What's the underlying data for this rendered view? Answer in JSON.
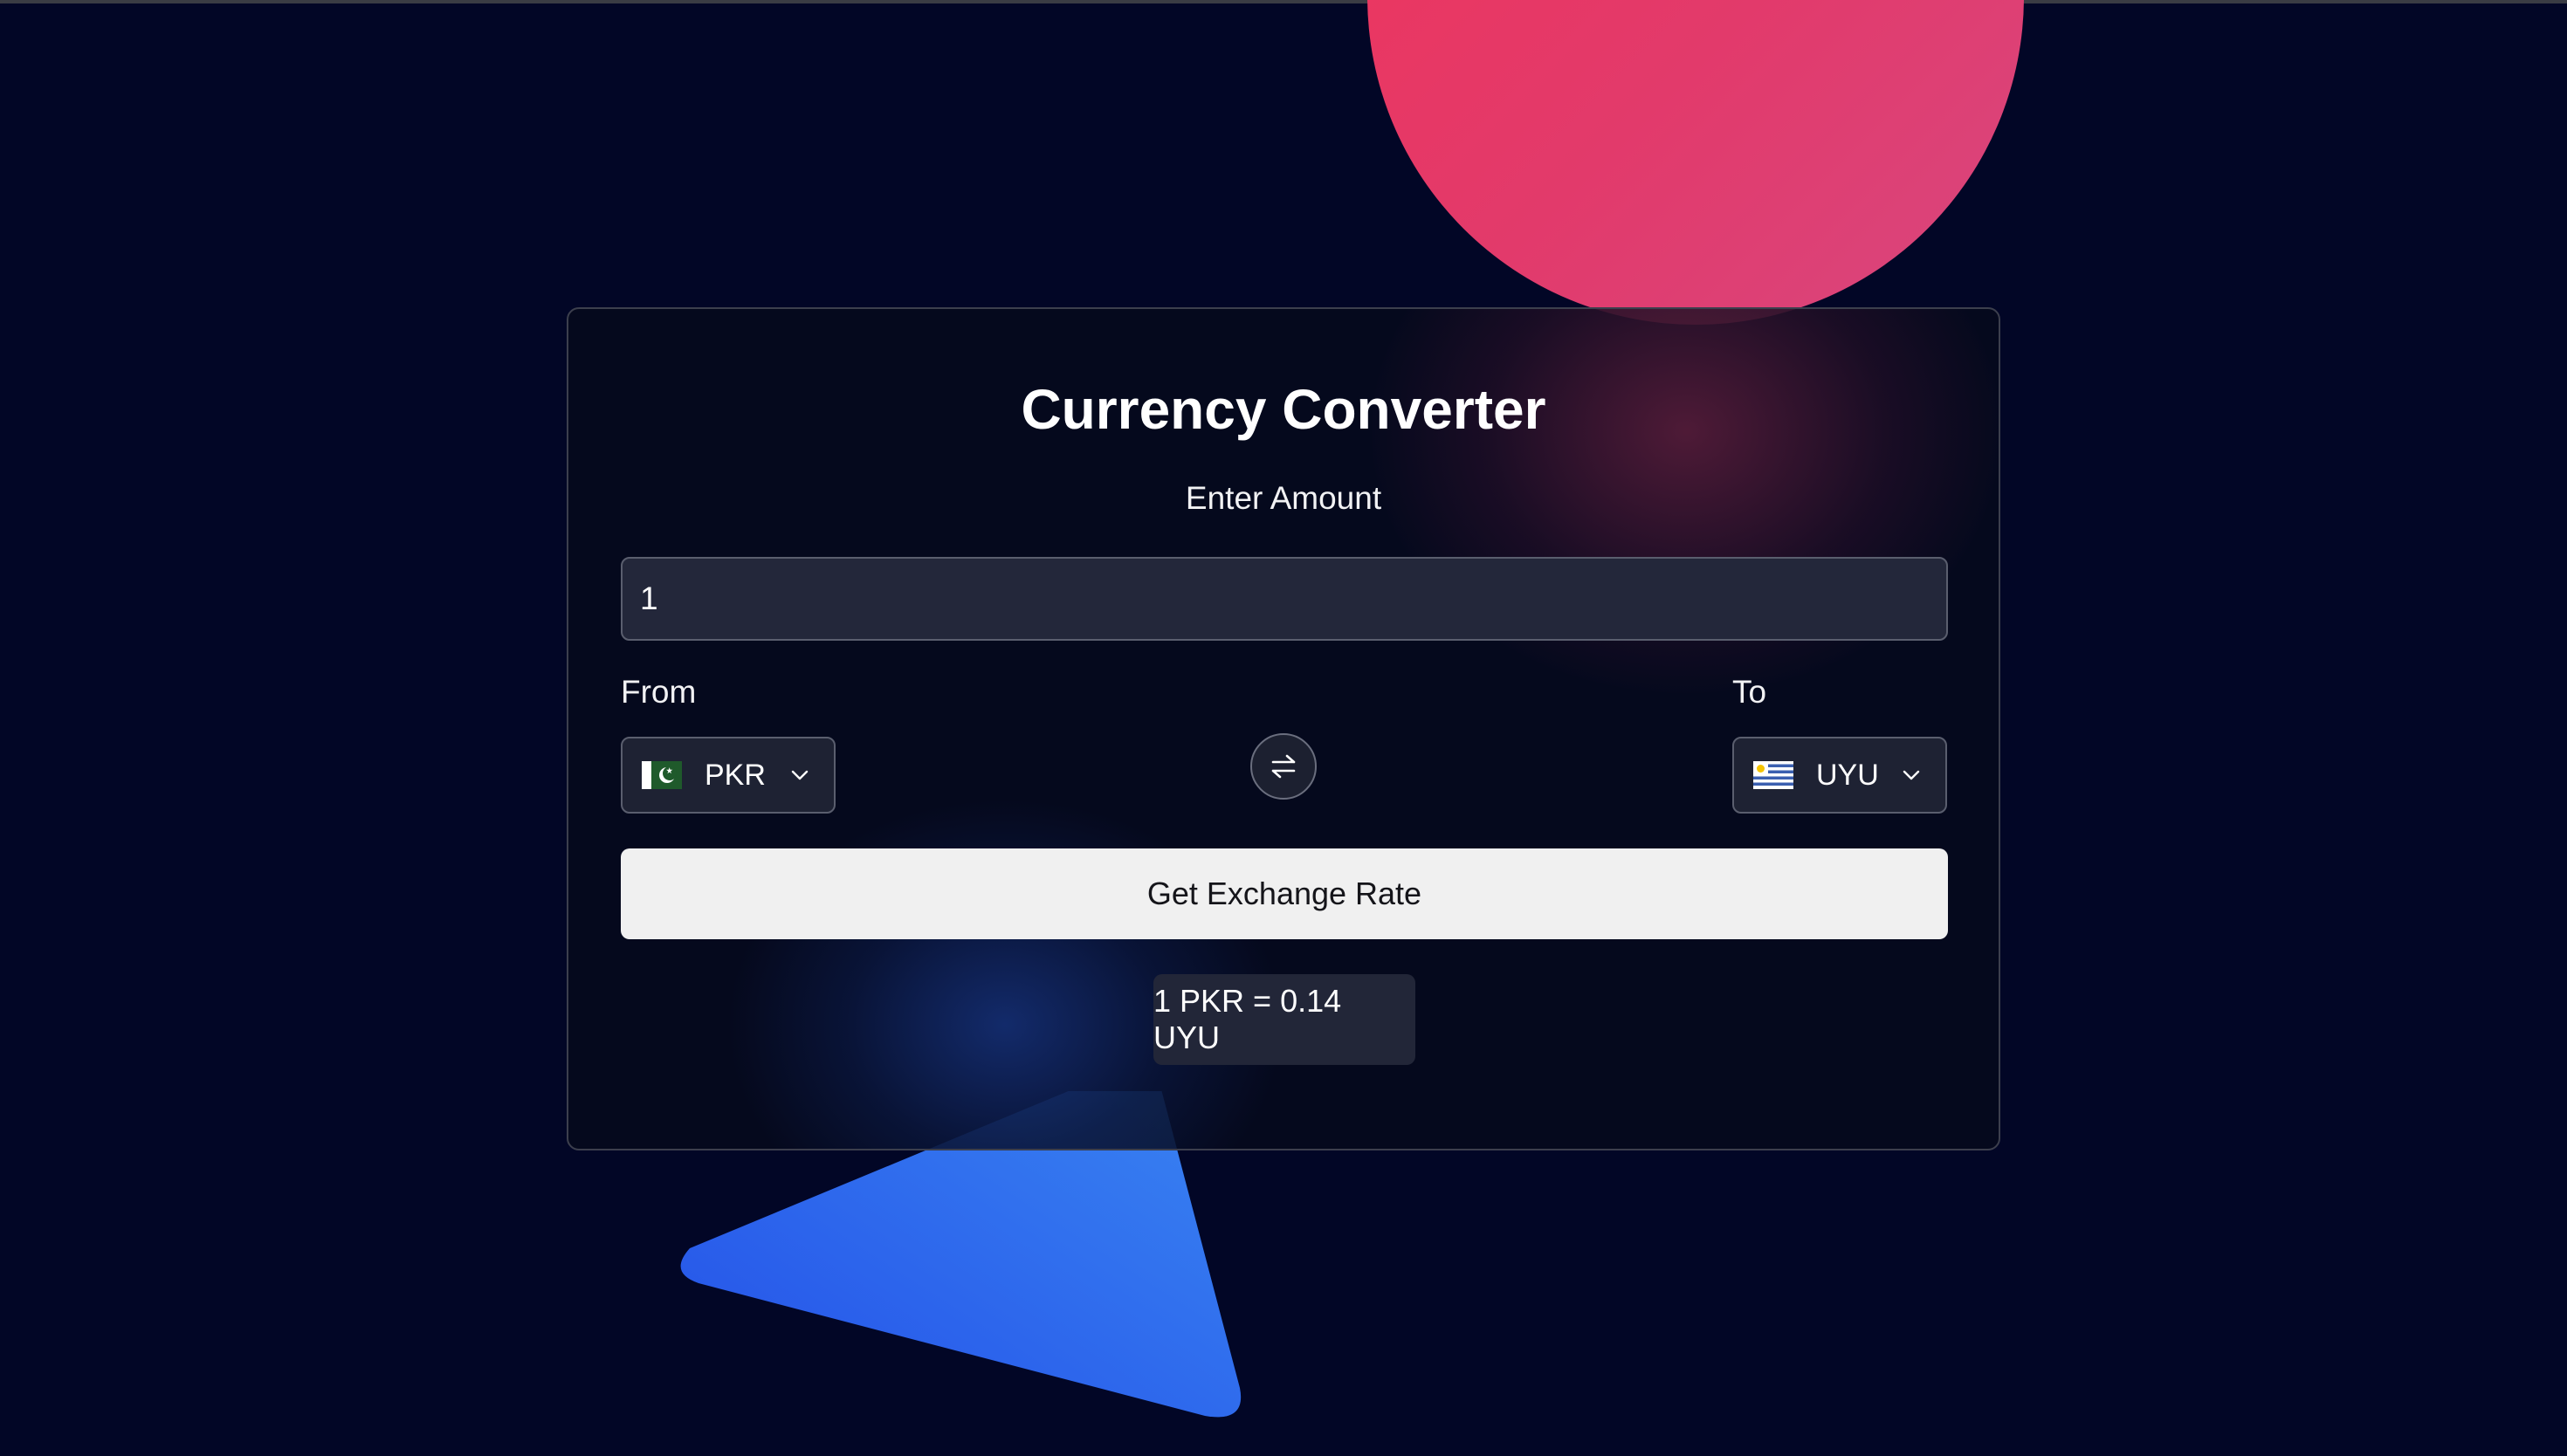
{
  "app": {
    "title": "Currency Converter"
  },
  "amount": {
    "label": "Enter Amount",
    "value": "1"
  },
  "from": {
    "label": "From",
    "currency": "PKR",
    "flag_icon": "pakistan-flag-icon"
  },
  "to": {
    "label": "To",
    "currency": "UYU",
    "flag_icon": "uruguay-flag-icon"
  },
  "swap": {
    "icon": "swap-arrows-icon"
  },
  "action": {
    "button_label": "Get Exchange Rate"
  },
  "result": {
    "text": "1 PKR = 0.14 UYU"
  },
  "colors": {
    "background": "#020626",
    "circle": "#e5386a",
    "triangle": "#2e6cf0",
    "button": "#f0f0f0"
  }
}
